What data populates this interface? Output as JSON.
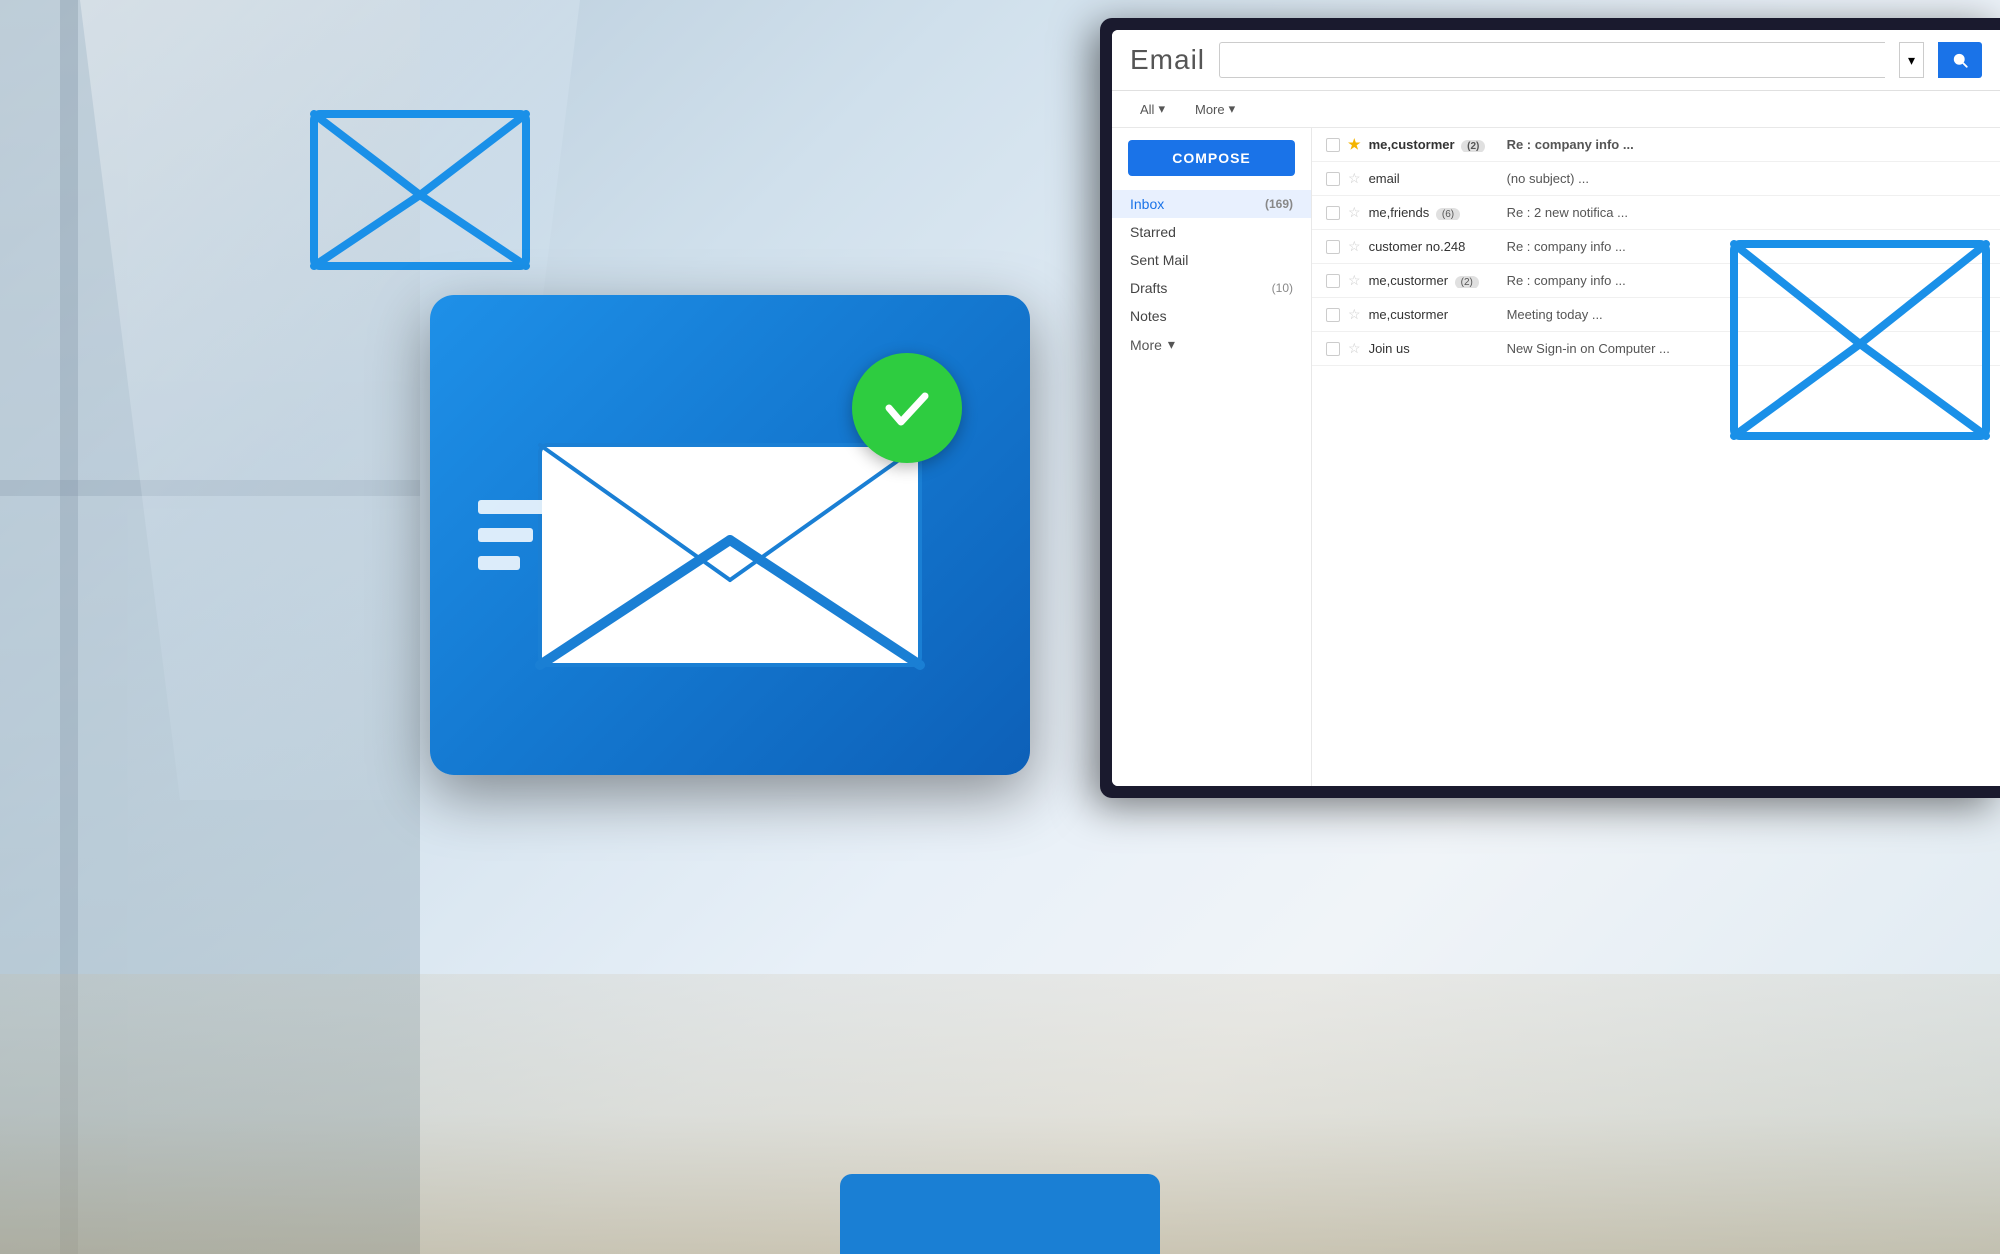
{
  "app": {
    "title": "Email",
    "search_placeholder": "",
    "search_dropdown_label": "▼"
  },
  "toolbar": {
    "all_label": "All",
    "all_dropdown": "▾",
    "more_label": "More",
    "more_dropdown": "▾"
  },
  "sidebar": {
    "compose_label": "COMPOSE",
    "items": [
      {
        "label": "Inbox",
        "count": "(169)",
        "has_count": true,
        "active": true
      },
      {
        "label": "Starred",
        "count": "",
        "has_count": false
      },
      {
        "label": "Sent Mail",
        "count": "",
        "has_count": false
      },
      {
        "label": "Drafts",
        "count": "(10)",
        "has_count": true
      },
      {
        "label": "Notes",
        "count": "",
        "has_count": false
      },
      {
        "label": "More",
        "count": "",
        "has_count": false,
        "is_more": true
      }
    ]
  },
  "emails": [
    {
      "sender": "me,custormer",
      "sender_badge": "(2)",
      "starred": true,
      "subject": "Re : company info ...",
      "unread": true
    },
    {
      "sender": "email",
      "sender_badge": "",
      "starred": false,
      "subject": "(no subject) ...",
      "unread": false
    },
    {
      "sender": "me,friends",
      "sender_badge": "(6)",
      "starred": false,
      "subject": "Re : 2 new notifica ...",
      "unread": false
    },
    {
      "sender": "customer no.248",
      "sender_badge": "",
      "starred": false,
      "subject": "Re : company info ...",
      "unread": false
    },
    {
      "sender": "me,custormer",
      "sender_badge": "(2)",
      "starred": false,
      "subject": "Re : company info ...",
      "unread": false
    },
    {
      "sender": "me,custormer",
      "sender_badge": "",
      "starred": false,
      "subject": "Meeting today ...",
      "unread": false
    },
    {
      "sender": "Join us",
      "sender_badge": "",
      "starred": false,
      "subject": "New Sign-in on Computer ...",
      "unread": false
    }
  ],
  "icons": {
    "search": "🔍",
    "checkmark": "✔",
    "star_empty": "☆",
    "star_filled": "★",
    "chevron_down": "▾"
  },
  "colors": {
    "blue_primary": "#1a73e8",
    "blue_card": "#1a82e8",
    "green_check": "#2ecc40",
    "envelope_blue": "#1a7fd4"
  }
}
